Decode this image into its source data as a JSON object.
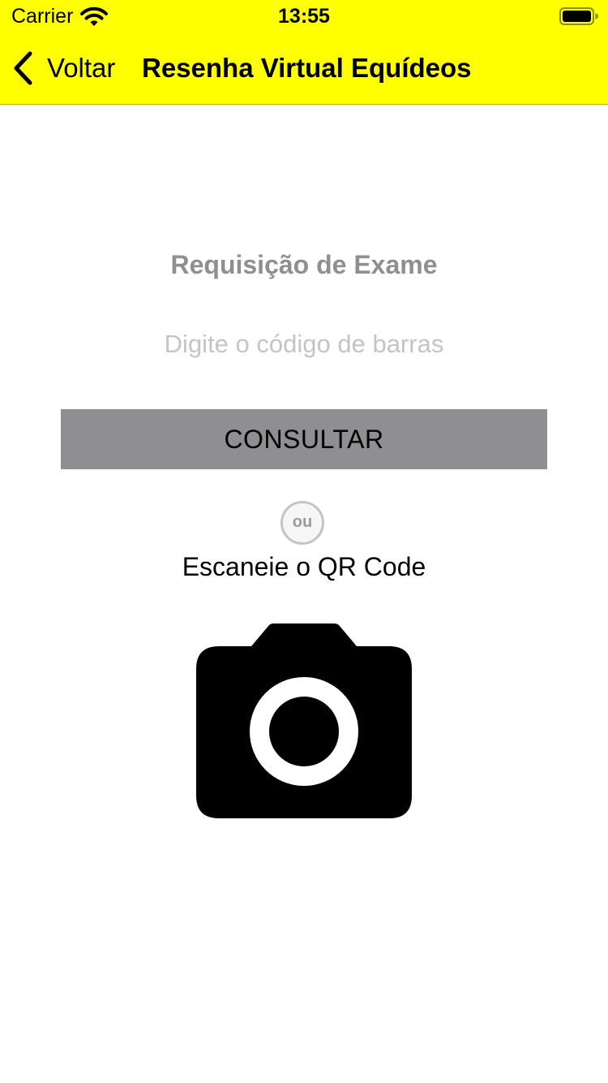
{
  "status_bar": {
    "carrier": "Carrier",
    "time": "13:55"
  },
  "nav": {
    "back_label": "Voltar",
    "title": "Resenha Virtual Equídeos"
  },
  "form": {
    "section_title": "Requisição de Exame",
    "barcode_placeholder": "Digite o código de barras",
    "barcode_value": "",
    "consult_label": "CONSULTAR"
  },
  "divider": {
    "or_label": "ou"
  },
  "scan": {
    "label": "Escaneie o QR Code",
    "icon": "camera-icon"
  },
  "colors": {
    "header_background": "#ffff00",
    "button_background": "#8e8e93",
    "section_title": "#8e8e93",
    "placeholder": "#c4c4c6"
  }
}
